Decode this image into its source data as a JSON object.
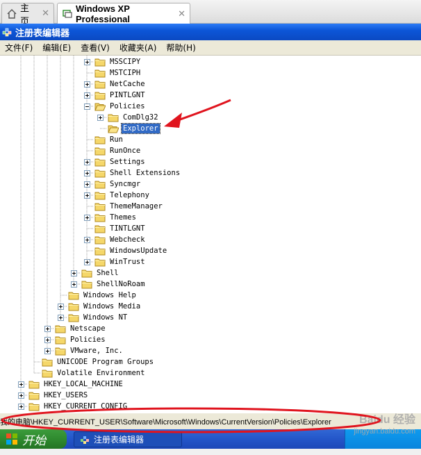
{
  "vm_tabs": [
    {
      "label": "主页"
    },
    {
      "label": "Windows XP Professional"
    }
  ],
  "window": {
    "title": "注册表编辑器"
  },
  "menu": [
    "文件(F)",
    "编辑(E)",
    "查看(V)",
    "收藏夹(A)",
    "帮助(H)"
  ],
  "tree": [
    {
      "label": "MSSCIPY",
      "depth": 5,
      "expander": "plus"
    },
    {
      "label": "MSTCIPH",
      "depth": 5,
      "expander": "none"
    },
    {
      "label": "NetCache",
      "depth": 5,
      "expander": "plus"
    },
    {
      "label": "PINTLGNT",
      "depth": 5,
      "expander": "plus"
    },
    {
      "label": "Policies",
      "depth": 5,
      "expander": "minus"
    },
    {
      "label": "ComDlg32",
      "depth": 6,
      "expander": "plus"
    },
    {
      "label": "Explorer",
      "depth": 6,
      "expander": "none",
      "selected": true
    },
    {
      "label": "Run",
      "depth": 5,
      "expander": "none"
    },
    {
      "label": "RunOnce",
      "depth": 5,
      "expander": "none"
    },
    {
      "label": "Settings",
      "depth": 5,
      "expander": "plus"
    },
    {
      "label": "Shell Extensions",
      "depth": 5,
      "expander": "plus"
    },
    {
      "label": "Syncmgr",
      "depth": 5,
      "expander": "plus"
    },
    {
      "label": "Telephony",
      "depth": 5,
      "expander": "plus"
    },
    {
      "label": "ThemeManager",
      "depth": 5,
      "expander": "none"
    },
    {
      "label": "Themes",
      "depth": 5,
      "expander": "plus"
    },
    {
      "label": "TINTLGNT",
      "depth": 5,
      "expander": "none"
    },
    {
      "label": "Webcheck",
      "depth": 5,
      "expander": "plus"
    },
    {
      "label": "WindowsUpdate",
      "depth": 5,
      "expander": "none"
    },
    {
      "label": "WinTrust",
      "depth": 5,
      "expander": "plus"
    },
    {
      "label": "Shell",
      "depth": 4,
      "expander": "plus"
    },
    {
      "label": "ShellNoRoam",
      "depth": 4,
      "expander": "plus"
    },
    {
      "label": "Windows Help",
      "depth": 3,
      "expander": "none"
    },
    {
      "label": "Windows Media",
      "depth": 3,
      "expander": "plus"
    },
    {
      "label": "Windows NT",
      "depth": 3,
      "expander": "plus"
    },
    {
      "label": "Netscape",
      "depth": 2,
      "expander": "plus"
    },
    {
      "label": "Policies",
      "depth": 2,
      "expander": "plus"
    },
    {
      "label": "VMware, Inc.",
      "depth": 2,
      "expander": "plus"
    },
    {
      "label": "UNICODE Program Groups",
      "depth": 1,
      "expander": "none"
    },
    {
      "label": "Volatile Environment",
      "depth": 1,
      "expander": "none"
    },
    {
      "label": "HKEY_LOCAL_MACHINE",
      "depth": 0,
      "expander": "plus"
    },
    {
      "label": "HKEY_USERS",
      "depth": 0,
      "expander": "plus"
    },
    {
      "label": "HKEY_CURRENT_CONFIG",
      "depth": 0,
      "expander": "plus"
    }
  ],
  "status": {
    "path": "我的电脑\\HKEY_CURRENT_USER\\Software\\Microsoft\\Windows\\CurrentVersion\\Policies\\Explorer"
  },
  "taskbar": {
    "start_label": "开始",
    "task_label": "注册表编辑器"
  },
  "watermark": {
    "line1": "Baidu 经验",
    "line2": "jingyan.baidu.com"
  },
  "colors": {
    "annotation_red": "#e0141e",
    "selection_blue": "#316ac5",
    "xp_title_blue": "#0c56d8",
    "start_green": "#2f8a2f"
  }
}
